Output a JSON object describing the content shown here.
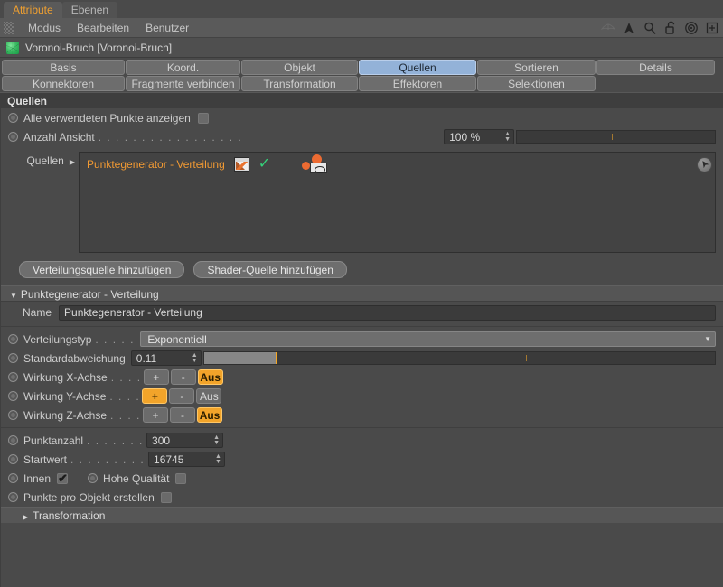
{
  "window": {
    "doc_tabs": [
      {
        "label": "Attribute",
        "active": true
      },
      {
        "label": "Ebenen",
        "active": false
      }
    ]
  },
  "menubar": {
    "grip_icon": "grip-dots-icon",
    "items": [
      "Modus",
      "Bearbeiten",
      "Benutzer"
    ],
    "right_icons": [
      "flat-manta-icon",
      "arrow-cursor-icon",
      "magnifier-icon",
      "lock-open-icon",
      "target-icon",
      "plus-box-icon"
    ]
  },
  "object_header": {
    "icon": "voronoi-fracture-green-cube-icon",
    "title": "Voronoi-Bruch [Voronoi-Bruch]"
  },
  "tabs": {
    "row1": [
      {
        "label": "Basis",
        "active": false,
        "width": 136
      },
      {
        "label": "Koord.",
        "active": false,
        "width": 127
      },
      {
        "label": "Objekt",
        "active": false,
        "width": 129
      },
      {
        "label": "Quellen",
        "active": true,
        "width": 130
      },
      {
        "label": "Sortieren",
        "active": false,
        "width": 131
      },
      {
        "label": "Details",
        "active": false,
        "width": 131
      }
    ],
    "row2": [
      {
        "label": "Konnektoren",
        "active": false,
        "width": 136
      },
      {
        "label": "Fragmente verbinden",
        "active": false,
        "width": 127
      },
      {
        "label": "Transformation",
        "active": false,
        "width": 129
      },
      {
        "label": "Effektoren",
        "active": false,
        "width": 130
      },
      {
        "label": "Selektionen",
        "active": false,
        "width": 131
      }
    ]
  },
  "section": {
    "title": "Quellen"
  },
  "options": {
    "show_all_points": {
      "label": "Alle verwendeten Punkte anzeigen",
      "checked": false
    },
    "count_view": {
      "label": "Anzahl Ansicht",
      "value": "100 %",
      "slider_fill_pct": 0,
      "slider_tick_pct": 48
    }
  },
  "sources": {
    "label": "Quellen",
    "expand_icon": "chevron-right-icon",
    "items": [
      {
        "name": "Punktegenerator - Verteilung",
        "thumb_icon": "image-thumbnail-icon",
        "status_icon": "green-check-icon",
        "type_icon": "point-generator-visibility-icon"
      }
    ],
    "corner_icon": "cursor-circle-icon"
  },
  "add_buttons": [
    {
      "label": "Verteilungsquelle hinzufügen"
    },
    {
      "label": "Shader-Quelle hinzufügen"
    }
  ],
  "generator": {
    "group_title": "Punktegenerator - Verteilung",
    "group_tri": "triangle-down-icon",
    "name_label": "Name",
    "name_value": "Punktegenerator - Verteilung",
    "distribution_type": {
      "label": "Verteilungstyp",
      "value": "Exponentiell",
      "caret": "chevron-down-icon"
    },
    "std_deviation": {
      "label": "Standardabweichung",
      "value": "0.11",
      "slider_fill_pct": 14,
      "slider_mark_pct": 14,
      "slider_tick_pct": 63
    },
    "axis_effects": [
      {
        "label": "Wirkung X-Achse",
        "plus": "+",
        "minus": "-",
        "off": "Aus",
        "active": "off"
      },
      {
        "label": "Wirkung Y-Achse",
        "plus": "+",
        "minus": "-",
        "off": "Aus",
        "active": "plus"
      },
      {
        "label": "Wirkung Z-Achse",
        "plus": "+",
        "minus": "-",
        "off": "Aus",
        "active": "off"
      }
    ],
    "point_count": {
      "label": "Punktanzahl",
      "value": "300"
    },
    "seed": {
      "label": "Startwert",
      "value": "16745"
    },
    "inside": {
      "label": "Innen",
      "checked": true
    },
    "high_quality": {
      "label": "Hohe Qualität",
      "checked": false
    },
    "points_per_object": {
      "label": "Punkte pro Objekt erstellen",
      "checked": false
    },
    "transformation": {
      "label": "Transformation",
      "tri": "triangle-right-icon"
    }
  },
  "colors": {
    "accent_orange": "#f2a42a",
    "source_text_orange": "#f29a33",
    "active_tab_blue": "#93b2d8",
    "check_green": "#35d17a",
    "panel_bg": "#4a4a4a"
  }
}
